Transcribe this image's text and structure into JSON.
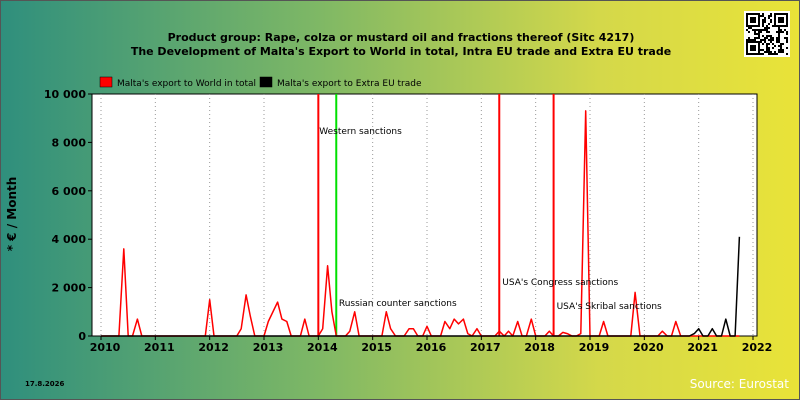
{
  "chart_data": {
    "type": "line",
    "title": "Product group: Rape, colza or mustard oil and fractions thereof (Sitc 4217)",
    "subtitle": "The Development of Malta's Export to World in total, Intra EU trade and Extra EU trade",
    "ylabel": "* € / Month",
    "xlabel": "",
    "ylim": [
      0,
      10000
    ],
    "xlim": [
      2010,
      2022
    ],
    "yticks": [
      "0",
      "2 000",
      "4 000",
      "6 000",
      "8 000",
      "10 000"
    ],
    "xticks": [
      "2010",
      "2011",
      "2012",
      "2013",
      "2014",
      "2015",
      "2016",
      "2017",
      "2018",
      "2019",
      "2020",
      "2021",
      "2022"
    ],
    "grid": "vertical dotted",
    "legend_position": "top-left",
    "legend": [
      "Malta's export to World in total",
      "Malta's export to Extra EU trade"
    ],
    "series": [
      {
        "name": "Malta's export to World in total",
        "color": "#ff0000",
        "points": [
          [
            2010.0,
            0
          ],
          [
            2010.33,
            0
          ],
          [
            2010.42,
            3600
          ],
          [
            2010.5,
            0
          ],
          [
            2010.58,
            0
          ],
          [
            2010.67,
            700
          ],
          [
            2010.75,
            0
          ],
          [
            2010.83,
            0
          ],
          [
            2011.83,
            0
          ],
          [
            2011.92,
            0
          ],
          [
            2012.0,
            1500
          ],
          [
            2012.08,
            0
          ],
          [
            2012.5,
            0
          ],
          [
            2012.58,
            300
          ],
          [
            2012.67,
            1700
          ],
          [
            2012.75,
            800
          ],
          [
            2012.83,
            0
          ],
          [
            2012.92,
            0
          ],
          [
            2013.0,
            0
          ],
          [
            2013.08,
            600
          ],
          [
            2013.25,
            1400
          ],
          [
            2013.33,
            700
          ],
          [
            2013.42,
            600
          ],
          [
            2013.5,
            0
          ],
          [
            2013.67,
            0
          ],
          [
            2013.75,
            700
          ],
          [
            2013.83,
            0
          ],
          [
            2013.92,
            0
          ],
          [
            2014.0,
            0
          ],
          [
            2014.08,
            300
          ],
          [
            2014.17,
            2900
          ],
          [
            2014.25,
            1000
          ],
          [
            2014.33,
            0
          ],
          [
            2014.5,
            0
          ],
          [
            2014.58,
            200
          ],
          [
            2014.67,
            1000
          ],
          [
            2014.75,
            0
          ],
          [
            2015.17,
            0
          ],
          [
            2015.25,
            1000
          ],
          [
            2015.33,
            300
          ],
          [
            2015.42,
            0
          ],
          [
            2015.58,
            0
          ],
          [
            2015.67,
            300
          ],
          [
            2015.75,
            300
          ],
          [
            2015.83,
            0
          ],
          [
            2015.92,
            0
          ],
          [
            2016.0,
            400
          ],
          [
            2016.08,
            0
          ],
          [
            2016.25,
            0
          ],
          [
            2016.33,
            600
          ],
          [
            2016.42,
            300
          ],
          [
            2016.5,
            700
          ],
          [
            2016.58,
            500
          ],
          [
            2016.67,
            700
          ],
          [
            2016.75,
            100
          ],
          [
            2016.83,
            0
          ],
          [
            2016.92,
            300
          ],
          [
            2017.0,
            0
          ],
          [
            2017.25,
            0
          ],
          [
            2017.33,
            200
          ],
          [
            2017.42,
            0
          ],
          [
            2017.5,
            200
          ],
          [
            2017.58,
            0
          ],
          [
            2017.67,
            600
          ],
          [
            2017.75,
            0
          ],
          [
            2017.83,
            0
          ],
          [
            2017.92,
            700
          ],
          [
            2018.0,
            0
          ],
          [
            2018.17,
            0
          ],
          [
            2018.25,
            200
          ],
          [
            2018.33,
            0
          ],
          [
            2018.42,
            0
          ],
          [
            2018.5,
            150
          ],
          [
            2018.58,
            100
          ],
          [
            2018.67,
            0
          ],
          [
            2018.75,
            0
          ],
          [
            2018.83,
            100
          ],
          [
            2018.92,
            9300
          ],
          [
            2019.0,
            0
          ],
          [
            2019.17,
            0
          ],
          [
            2019.25,
            600
          ],
          [
            2019.33,
            0
          ],
          [
            2019.75,
            0
          ],
          [
            2019.83,
            1800
          ],
          [
            2019.92,
            0
          ],
          [
            2020.25,
            0
          ],
          [
            2020.33,
            200
          ],
          [
            2020.42,
            0
          ],
          [
            2020.5,
            0
          ],
          [
            2020.58,
            600
          ],
          [
            2020.67,
            0
          ],
          [
            2021.75,
            0
          ]
        ]
      },
      {
        "name": "Malta's export to Extra EU trade",
        "color": "#000000",
        "points": [
          [
            2010.0,
            0
          ],
          [
            2020.83,
            0
          ],
          [
            2020.92,
            100
          ],
          [
            2021.0,
            300
          ],
          [
            2021.08,
            0
          ],
          [
            2021.17,
            0
          ],
          [
            2021.25,
            300
          ],
          [
            2021.33,
            0
          ],
          [
            2021.42,
            0
          ],
          [
            2021.5,
            700
          ],
          [
            2021.58,
            0
          ],
          [
            2021.67,
            0
          ],
          [
            2021.75,
            4100
          ]
        ]
      }
    ],
    "markers": [
      {
        "label": "",
        "x": 2014.0,
        "color": "#ff0000"
      },
      {
        "label": "Western sanctions",
        "x": 2014.33,
        "color": "#00e000"
      },
      {
        "label": "Russian counter sanctions",
        "x": 2014.58,
        "color": ""
      },
      {
        "label": "USA's Congress sanctions",
        "x": 2017.33,
        "color": "#ff0000"
      },
      {
        "label": "USA's Skribal sanctions",
        "x": 2018.33,
        "color": "#ff0000"
      }
    ]
  },
  "footer": {
    "date": "17.8.2026",
    "source": "Source: Eurostat"
  }
}
